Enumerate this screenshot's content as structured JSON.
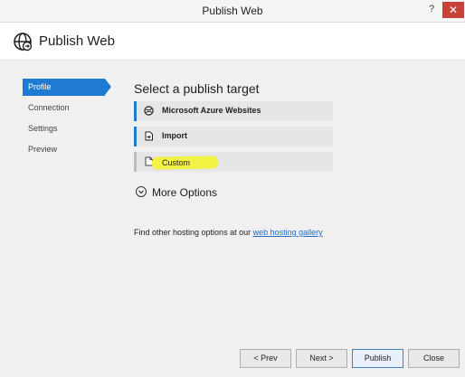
{
  "window": {
    "title": "Publish Web",
    "help_label": "?",
    "close_label": "✕"
  },
  "header": {
    "title": "Publish Web"
  },
  "nav": {
    "items": [
      {
        "label": "Profile"
      },
      {
        "label": "Connection"
      },
      {
        "label": "Settings"
      },
      {
        "label": "Preview"
      }
    ]
  },
  "main": {
    "heading": "Select a publish target",
    "targets": [
      {
        "label": "Microsoft Azure Websites",
        "icon": "azure-icon"
      },
      {
        "label": "Import",
        "icon": "import-icon"
      },
      {
        "label": "Custom",
        "icon": "document-icon"
      }
    ],
    "more_options": "More Options",
    "find_text": "Find other hosting options at our ",
    "find_link": "web hosting gallery"
  },
  "buttons": {
    "prev": "< Prev",
    "next": "Next >",
    "publish": "Publish",
    "close": "Close"
  },
  "colors": {
    "accent": "#1e7ad3",
    "highlight": "#f2f245",
    "close_button": "#c7433a"
  }
}
